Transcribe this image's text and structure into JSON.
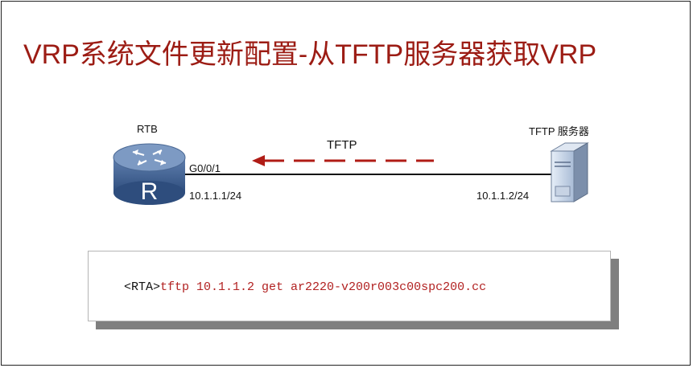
{
  "title": "VRP系统文件更新配置-从TFTP服务器获取VRP",
  "router": {
    "name": "RTB",
    "port": "G0/0/1",
    "ip": "10.1.1.1/24"
  },
  "server": {
    "name": "TFTP 服务器",
    "ip": "10.1.1.2/24"
  },
  "link": {
    "protocol": "TFTP"
  },
  "command": {
    "prompt": "<RTA>",
    "text": "tftp 10.1.1.2 get ar2220-v200r003c00spc200.cc"
  },
  "colors": {
    "title": "#9c1c14",
    "arrow": "#b01c16",
    "command": "#b22222"
  }
}
